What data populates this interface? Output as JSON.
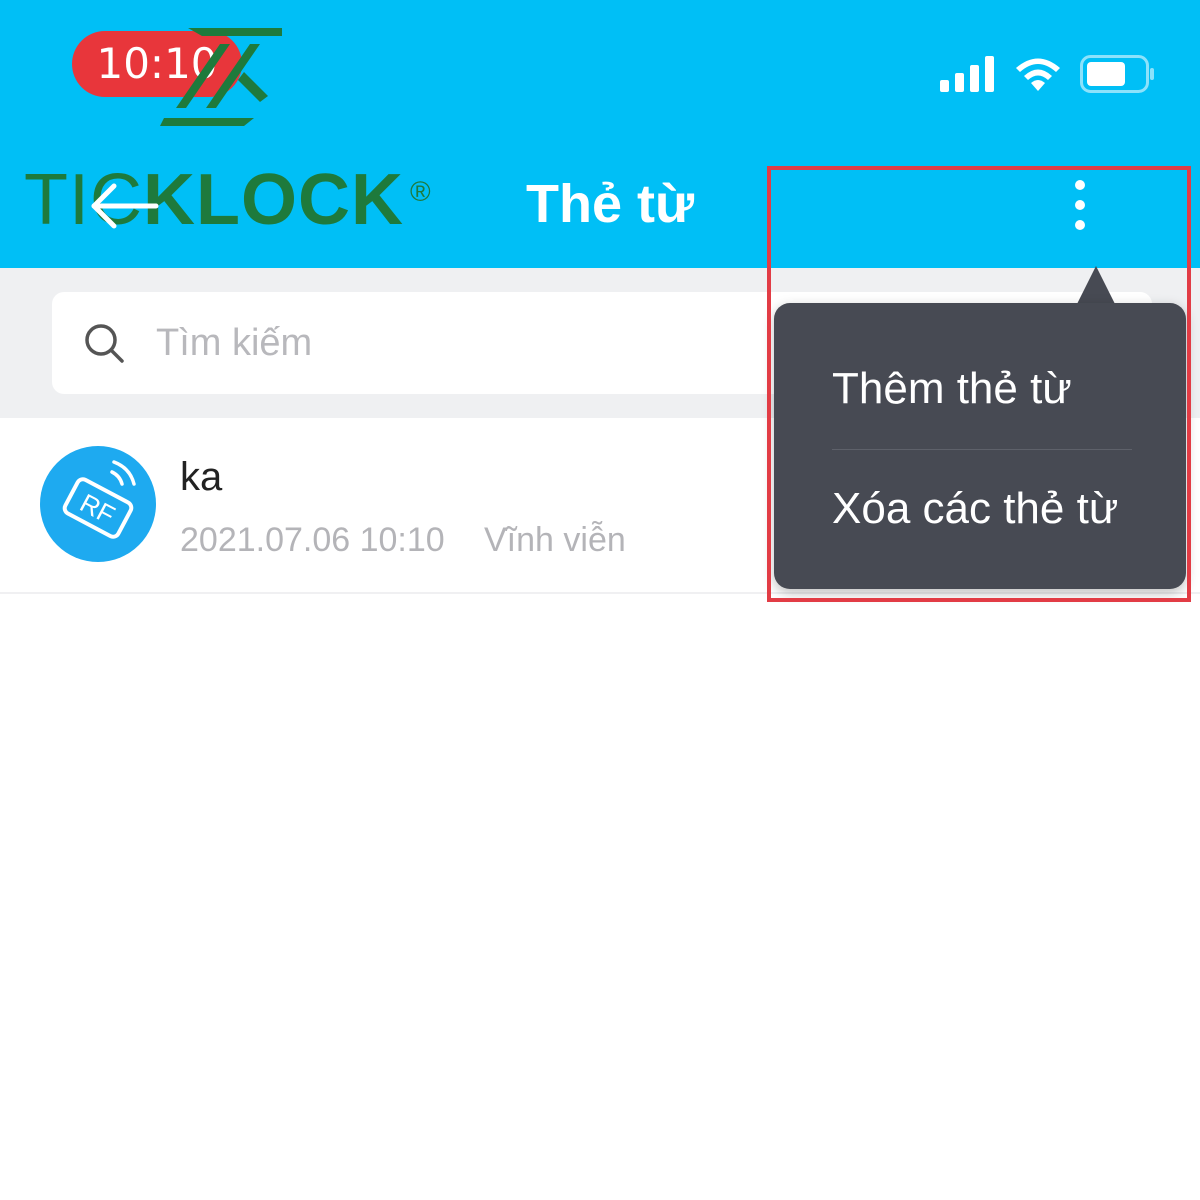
{
  "status_bar": {
    "time": "10:10",
    "time_pill_color": "#e8363b",
    "icons": [
      "signal-icon",
      "wifi-icon",
      "battery-icon"
    ]
  },
  "header": {
    "brand": {
      "part1": "TIC",
      "part2": "KLOCK",
      "registered": "®",
      "color": "#1e7a3c"
    },
    "title": "Thẻ từ",
    "background_color": "#00bff6"
  },
  "search": {
    "placeholder": "Tìm kiếm",
    "value": ""
  },
  "cards": [
    {
      "name": "ka",
      "date": "2021.07.06 10:10",
      "validity": "Vĩnh viễn",
      "avatar_icon": "rf-card-icon",
      "avatar_label": "RF"
    }
  ],
  "popup_menu": {
    "items": [
      {
        "label": "Thêm thẻ từ"
      },
      {
        "label": "Xóa các thẻ từ"
      }
    ],
    "background_color": "#474a53"
  },
  "highlight_color": "#e23c45"
}
